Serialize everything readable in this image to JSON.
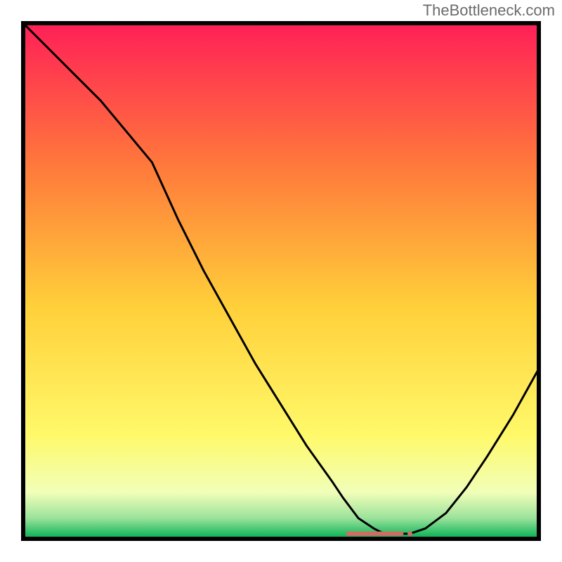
{
  "watermark": "TheBottleneck.com",
  "colors": {
    "gradient_top": "#ff1f57",
    "gradient_mid_upper": "#ff7a3b",
    "gradient_mid": "#ffd03a",
    "gradient_mid_lower": "#fff96a",
    "gradient_lower": "#f1ffb8",
    "gradient_bottom_inner": "#9be29b",
    "gradient_bottom": "#00b050",
    "curve": "#000000",
    "marker": "#d46a63",
    "frame": "#000000"
  },
  "chart_data": {
    "type": "line",
    "title": "",
    "xlabel": "",
    "ylabel": "",
    "xlim": [
      0,
      100
    ],
    "ylim": [
      0,
      100
    ],
    "comment": "Values are approximate, read off the raster. y=0 is the bottom green band (optimum); y=100 is the top of the frame (severe bottleneck).",
    "x": [
      0,
      5,
      10,
      15,
      20,
      25,
      30,
      35,
      40,
      45,
      50,
      55,
      60,
      62,
      65,
      68,
      70,
      72,
      75,
      78,
      82,
      86,
      90,
      95,
      100
    ],
    "y": [
      100,
      95,
      90,
      85,
      79,
      73,
      62,
      52,
      43,
      34,
      26,
      18,
      11,
      8,
      4,
      2,
      1,
      1,
      1,
      2,
      5,
      10,
      16,
      24,
      33
    ],
    "optimum_marker": {
      "x_start": 63,
      "x_end": 75,
      "y": 1
    }
  }
}
